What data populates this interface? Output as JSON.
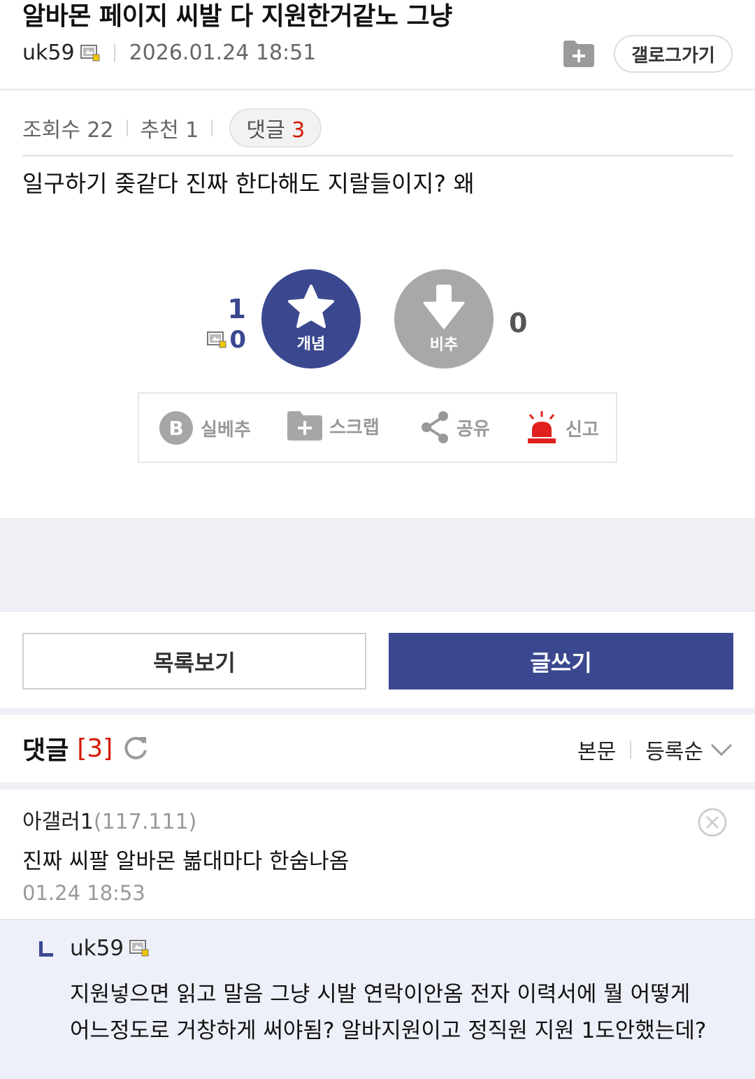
{
  "post": {
    "title": "알바몬 페이지 씨발 다 지원한거같노 그냥",
    "author": "uk59",
    "date": "2026.01.24 18:51",
    "gallery_button": "갤로그가기",
    "views_label": "조회수 22",
    "recommend_label": "추천 1",
    "comment_label": "댓글",
    "comment_count": "3",
    "body": "일구하기 좆같다 진짜 한다해도 지랄들이지? 왜"
  },
  "vote": {
    "recommend_count": "1",
    "fixed_member_count": "0",
    "recommend_label": "개념",
    "nonrecommend_label": "비추",
    "nonrecommend_count": "0"
  },
  "actions": {
    "best": "실베추",
    "scrap": "스크랩",
    "share": "공유",
    "report": "신고",
    "best_letter": "B"
  },
  "buttons": {
    "list": "목록보기",
    "write": "글쓰기"
  },
  "comments": {
    "header_label": "댓글",
    "header_count": "[3]",
    "sort_body": "본문",
    "sort_order": "등록순",
    "items": [
      {
        "nick": "아갤러1",
        "ip": "(117.111)",
        "text": "진짜 씨팔 알바몬 볾대마다 한숨나옴",
        "date": "01.24 18:53"
      }
    ],
    "reply": {
      "nick": "uk59",
      "text": "지원넣으면 읽고 말음 그냥 시발 연락이안옴 전자 이력서에 뭘 어떻게 어느정도로 거창하게 써야됨? 알바지원이고 정직원 지원 1도안했는데?"
    }
  },
  "colors": {
    "accent": "#3b4890",
    "red": "#d31900",
    "gray_button": "#a8a8aa",
    "band": "#eef0f6"
  },
  "icons": [
    "member-icon",
    "scrap-folder-icon",
    "star-icon",
    "down-arrow-icon",
    "best-b-icon",
    "share-icon",
    "siren-icon",
    "refresh-icon",
    "chevron-down-icon",
    "delete-icon",
    "reply-arrow-icon"
  ]
}
